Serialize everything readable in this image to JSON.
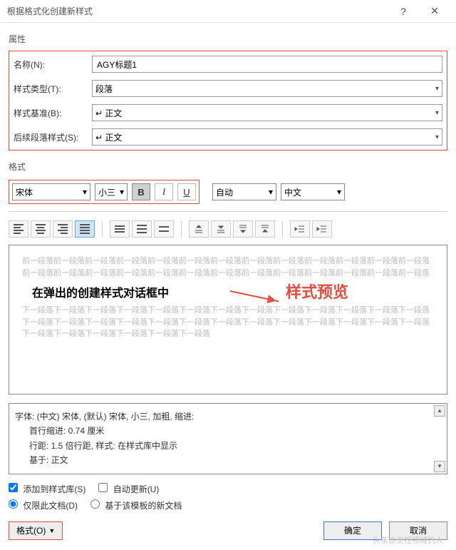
{
  "window": {
    "title": "根据格式化创建新样式"
  },
  "properties": {
    "section_label": "属性",
    "name_label": "名称(N):",
    "name_value": "AGY标题1",
    "type_label": "样式类型(T):",
    "type_value": "段落",
    "based_label": "样式基准(B):",
    "based_value": "↵ 正文",
    "next_label": "后续段落样式(S):",
    "next_value": "↵ 正文"
  },
  "format": {
    "section_label": "格式",
    "font_name": "宋体",
    "font_size": "小三",
    "bold": "B",
    "italic": "I",
    "underline": "U",
    "color": "自动",
    "lang": "中文"
  },
  "preview": {
    "before_text": "前一段落前一段落前一段落前一段落前一段落前一段落前一段落前一段落前一段落前一段落前一段落前一段落前一段落前一段落前一段落前一段落前一段落前一段落前一段落前一段落前一段落前一段落前一段落前一段落前一段落前一段落",
    "sample_text": "在弹出的创建样式对话框中",
    "after_text": "下一段落下一段落下一段落下一段落下一段落下一段落下一段落下一段落下一段落下一段落下一段落下一段落下一段落下一段落下一段落下一段落下一段落下一段落下一段落下一段落下一段落下一段落下一段落下一段落下一段落下一段落下一段落下一段落下一段落下一段落下一段落下一段落",
    "annotation": "样式预览"
  },
  "description": {
    "line1": "字体: (中文) 宋体, (默认) 宋体, 小三, 加粗, 缩进:",
    "line2": "首行缩进: 0.74 厘米",
    "line3": "行距: 1.5 倍行距, 样式: 在样式库中显示",
    "line4": "基于: 正文"
  },
  "options": {
    "add_gallery": "添加到样式库(S)",
    "auto_update": "自动更新(U)",
    "only_doc": "仅限此文档(D)",
    "template_based": "基于该模板的新文档"
  },
  "footer": {
    "format_btn": "格式(O)",
    "ok": "确定",
    "cancel": "取消"
  },
  "watermark": "头条@工控领域钓人"
}
